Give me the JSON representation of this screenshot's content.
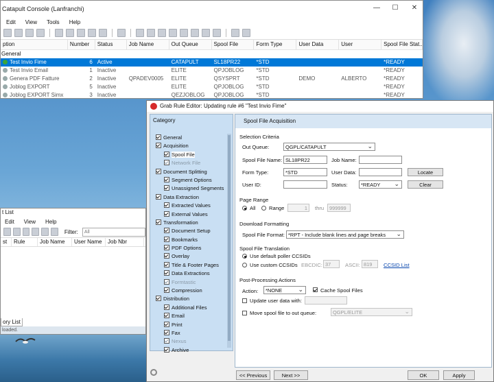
{
  "console": {
    "title": "Catapult Console (Lanfranchi)",
    "menu": [
      "Edit",
      "View",
      "Tools",
      "Help"
    ],
    "columns": [
      "ption",
      "Number",
      "Status",
      "Job Name",
      "Out Queue",
      "Spool File",
      "Form Type",
      "User Data",
      "User",
      "Spool File Stat..."
    ],
    "group": "General",
    "rows": [
      {
        "name": "Test Invio Fime",
        "number": "6",
        "status": "Active",
        "job": "",
        "outq": "CATAPULT",
        "spool": "SL18PR22",
        "form": "*STD",
        "udata": "",
        "user": "",
        "sfstat": "*READY",
        "selected": true,
        "active": true
      },
      {
        "name": "Test Invio Email",
        "number": "1",
        "status": "Inactive",
        "job": "",
        "outq": "ELITE",
        "spool": "QPJOBLOG",
        "form": "*STD",
        "udata": "",
        "user": "",
        "sfstat": "*READY",
        "selected": false,
        "active": false
      },
      {
        "name": "Genera PDF Fatture",
        "number": "2",
        "status": "Inactive",
        "job": "QPADEV0005",
        "outq": "ELITE",
        "spool": "QSYSPRT",
        "form": "*STD",
        "udata": "DEMO",
        "user": "ALBERTO",
        "sfstat": "*READY",
        "selected": false,
        "active": false
      },
      {
        "name": "Joblog EXPORT",
        "number": "5",
        "status": "Inactive",
        "job": "",
        "outq": "ELITE",
        "spool": "QPJOBLOG",
        "form": "*STD",
        "udata": "",
        "user": "",
        "sfstat": "*READY",
        "selected": false,
        "active": false
      },
      {
        "name": "Joblog EXPORT Simx",
        "number": "3",
        "status": "Inactive",
        "job": "",
        "outq": "QEZJOBLOG",
        "spool": "QPJOBLOG",
        "form": "*STD",
        "udata": "",
        "user": "",
        "sfstat": "*READY",
        "selected": false,
        "active": false
      }
    ]
  },
  "rulelist": {
    "title": "t List",
    "menu": [
      "Edit",
      "View",
      "Help"
    ],
    "filter_label": "Filter:",
    "filter_value": "All",
    "columns": [
      "st",
      "Rule",
      "Job Name",
      "User Name",
      "Job Nbr"
    ],
    "tab": "ory List",
    "status": "loaded."
  },
  "editor": {
    "title": "Grab Rule Editor: Updating rule #6 \"Test Invio Fime\"",
    "category_title": "Category",
    "tree": [
      {
        "label": "General",
        "level": 0,
        "grey": false
      },
      {
        "label": "Acquisition",
        "level": 0,
        "grey": false
      },
      {
        "label": "Spool File",
        "level": 1,
        "grey": false,
        "selected": true
      },
      {
        "label": "Network File",
        "level": 1,
        "grey": true
      },
      {
        "label": "Document Splitting",
        "level": 0,
        "grey": false
      },
      {
        "label": "Segment Options",
        "level": 1,
        "grey": false
      },
      {
        "label": "Unassigned Segments",
        "level": 1,
        "grey": false
      },
      {
        "label": "Data Extraction",
        "level": 0,
        "grey": false
      },
      {
        "label": "Extracted Values",
        "level": 1,
        "grey": false
      },
      {
        "label": "External Values",
        "level": 1,
        "grey": false
      },
      {
        "label": "Transformation",
        "level": 0,
        "grey": false
      },
      {
        "label": "Document Setup",
        "level": 1,
        "grey": false
      },
      {
        "label": "Bookmarks",
        "level": 1,
        "grey": false
      },
      {
        "label": "PDF Options",
        "level": 1,
        "grey": false
      },
      {
        "label": "Overlay",
        "level": 1,
        "grey": false
      },
      {
        "label": "Title & Footer Pages",
        "level": 1,
        "grey": false
      },
      {
        "label": "Data Extractions",
        "level": 1,
        "grey": false
      },
      {
        "label": "Formtastic",
        "level": 1,
        "grey": true
      },
      {
        "label": "Compression",
        "level": 1,
        "grey": false
      },
      {
        "label": "Distribution",
        "level": 0,
        "grey": false
      },
      {
        "label": "Additional Files",
        "level": 1,
        "grey": false
      },
      {
        "label": "Email",
        "level": 1,
        "grey": false
      },
      {
        "label": "Print",
        "level": 1,
        "grey": false
      },
      {
        "label": "Fax",
        "level": 1,
        "grey": false
      },
      {
        "label": "Nexus",
        "level": 1,
        "grey": true
      },
      {
        "label": "Archive",
        "level": 1,
        "grey": false
      }
    ],
    "pane_title": "Spool File Acquisition",
    "selection": {
      "section": "Selection Criteria",
      "outq_label": "Out Queue:",
      "outq_value": "QGPL/CATAPULT",
      "spool_label": "Spool File Name:",
      "spool_value": "SL18PR22",
      "job_label": "Job Name:",
      "job_value": "",
      "form_label": "Form Type:",
      "form_value": "*STD",
      "udata_label": "User Data:",
      "udata_value": "",
      "locate": "Locate",
      "userid_label": "User ID:",
      "userid_value": "",
      "status_label": "Status:",
      "status_value": "*READY",
      "clear": "Clear"
    },
    "page_range": {
      "section": "Page Range",
      "all": "All",
      "range": "Range",
      "from": "1",
      "thru_label": "thru",
      "thru": "999999"
    },
    "download": {
      "section": "Download Formatting",
      "format_label": "Spool File Format:",
      "format_value": "*RPT - Include blank lines and page breaks"
    },
    "translation": {
      "section": "Spool File Translation",
      "default": "Use default poller CCSIDs",
      "custom": "Use custom CCSIDs",
      "ebcdic_label": "EBCDIC:",
      "ebcdic": "37",
      "ascii_label": "ASCII:",
      "ascii": "819",
      "ccsid_link": "CCSID List"
    },
    "post": {
      "section": "Post-Processing Actions",
      "action_label": "Action:",
      "action_value": "*NONE",
      "cache": "Cache Spool Files",
      "update": "Update user data with:",
      "move": "Move spool file to out queue:",
      "move_value": "QGPL/ELITE"
    },
    "footer": {
      "previous": "<< Previous",
      "next": "Next >>",
      "ok": "OK",
      "apply": "Apply"
    }
  }
}
